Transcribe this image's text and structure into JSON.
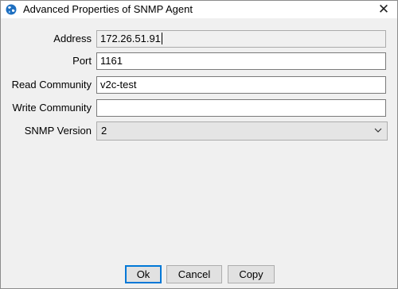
{
  "window": {
    "title": "Advanced Properties of SNMP Agent",
    "close_glyph": "✕"
  },
  "form": {
    "address": {
      "label": "Address",
      "value": "172.26.51.91"
    },
    "port": {
      "label": "Port",
      "value": "1161"
    },
    "read_community": {
      "label": "Read Community",
      "value": "v2c-test"
    },
    "write_community": {
      "label": "Write Community",
      "value": ""
    },
    "snmp_version": {
      "label": "SNMP Version",
      "value": "2"
    }
  },
  "buttons": {
    "ok": "Ok",
    "cancel": "Cancel",
    "copy": "Copy"
  },
  "icons": {
    "app": "globe-icon",
    "close": "close-icon",
    "dropdown": "chevron-down-icon"
  },
  "colors": {
    "dialog_bg": "#f0f0f0",
    "default_button_border": "#0078d7"
  }
}
